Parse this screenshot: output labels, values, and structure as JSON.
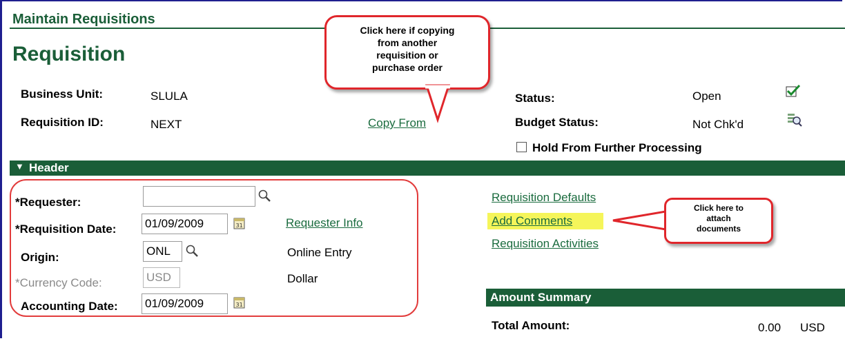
{
  "header": {
    "component_title": "Maintain Requisitions",
    "page_title": "Requisition"
  },
  "keys": {
    "business_unit_label": "Business Unit:",
    "business_unit_value": "SLULA",
    "requisition_id_label": "Requisition ID:",
    "requisition_id_value": "NEXT",
    "copy_from_link": "Copy From"
  },
  "status": {
    "status_label": "Status:",
    "status_value": "Open",
    "budget_status_label": "Budget Status:",
    "budget_status_value": "Not Chk'd",
    "hold_label": "Hold From Further Processing",
    "hold_checked": false
  },
  "callouts": {
    "copy_from": [
      "Click here if copying",
      "from another",
      "requisition or",
      "purchase order"
    ],
    "attach": [
      "Click here to",
      "attach",
      "documents"
    ]
  },
  "header_section": {
    "title": "Header",
    "requester_label": "*Requester:",
    "requester_value": "",
    "requisition_date_label": "*Requisition Date:",
    "requisition_date_value": "01/09/2009",
    "requester_info_link": "Requester Info",
    "origin_label": "Origin:",
    "origin_value": "ONL",
    "origin_description": "Online Entry",
    "currency_label": "*Currency Code:",
    "currency_value": "USD",
    "currency_description": "Dollar",
    "accounting_date_label": "Accounting Date:",
    "accounting_date_value": "01/09/2009"
  },
  "links": {
    "requisition_defaults": "Requisition Defaults",
    "add_comments": "Add Comments",
    "requisition_activities": "Requisition Activities"
  },
  "amount_summary": {
    "title": "Amount Summary",
    "total_label": "Total Amount:",
    "total_value": "0.00",
    "currency": "USD"
  },
  "colors": {
    "brand_green": "#1a5e38",
    "link_green": "#1a6b3e",
    "callout_red": "#e0262b",
    "highlight_yellow": "#f5f55a"
  }
}
